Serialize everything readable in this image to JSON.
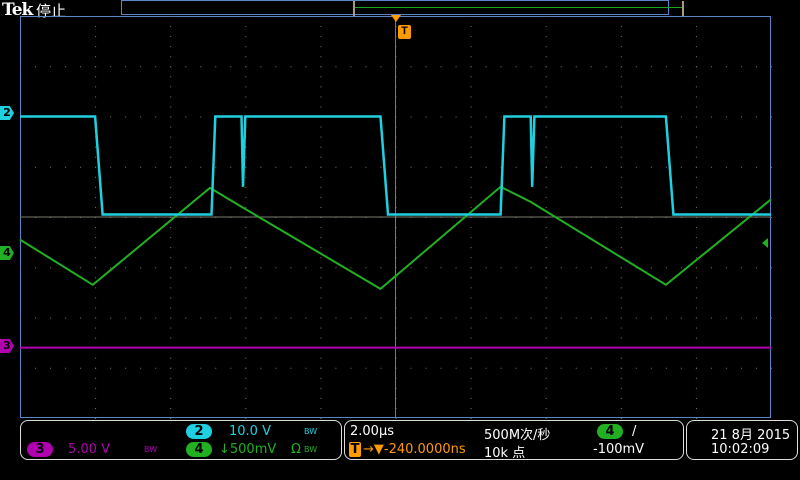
{
  "header": {
    "brand": "Tek",
    "state": "停止"
  },
  "colors": {
    "ch2": "#1fd0e0",
    "ch4": "#22b022",
    "ch3": "#b000b0",
    "trigger": "#ff9a00",
    "grid": "#7a7a6a"
  },
  "channels": [
    {
      "id": "2",
      "scale": "10.0 V",
      "bw": "BW",
      "coupling": ""
    },
    {
      "id": "3",
      "scale": "5.00 V",
      "bw": "BW",
      "coupling": ""
    },
    {
      "id": "4",
      "scale": "↓500mV",
      "bw": "BW",
      "coupling": "Ω"
    }
  ],
  "horizontal": {
    "timebase": "2.00µs",
    "trigger_pos_icon": "T",
    "delay": "→▼-240.0000ns",
    "sample_rate": "500M次/秒",
    "record_length": "10k 点"
  },
  "trigger": {
    "source": "4",
    "slope": "/",
    "level": "-100mV"
  },
  "datetime": {
    "date": "21 8月 2015",
    "time": "10:02:09"
  },
  "traces": {
    "ch2_divs": [
      [
        0,
        -2.0
      ],
      [
        1.0,
        -2.0
      ],
      [
        1.1,
        -0.05
      ],
      [
        2.55,
        -0.05
      ],
      [
        2.6,
        -2.0
      ],
      [
        2.95,
        -2.0
      ],
      [
        2.97,
        -0.6
      ],
      [
        3.0,
        -2.0
      ],
      [
        4.8,
        -2.0
      ],
      [
        4.9,
        -0.05
      ],
      [
        6.4,
        -0.05
      ],
      [
        6.45,
        -2.0
      ],
      [
        6.8,
        -2.0
      ],
      [
        6.82,
        -0.6
      ],
      [
        6.85,
        -2.0
      ],
      [
        8.6,
        -2.0
      ],
      [
        8.7,
        -0.05
      ],
      [
        10,
        -0.05
      ]
    ],
    "ch4_divs": [
      [
        0,
        0.45
      ],
      [
        0.97,
        1.35
      ],
      [
        2.53,
        -0.58
      ],
      [
        2.93,
        -0.22
      ],
      [
        4.8,
        1.43
      ],
      [
        6.4,
        -0.6
      ],
      [
        6.8,
        -0.3
      ],
      [
        8.6,
        1.35
      ],
      [
        10,
        -0.35
      ]
    ],
    "ch3_divs": [
      [
        0,
        2.6
      ],
      [
        10,
        2.6
      ]
    ]
  }
}
